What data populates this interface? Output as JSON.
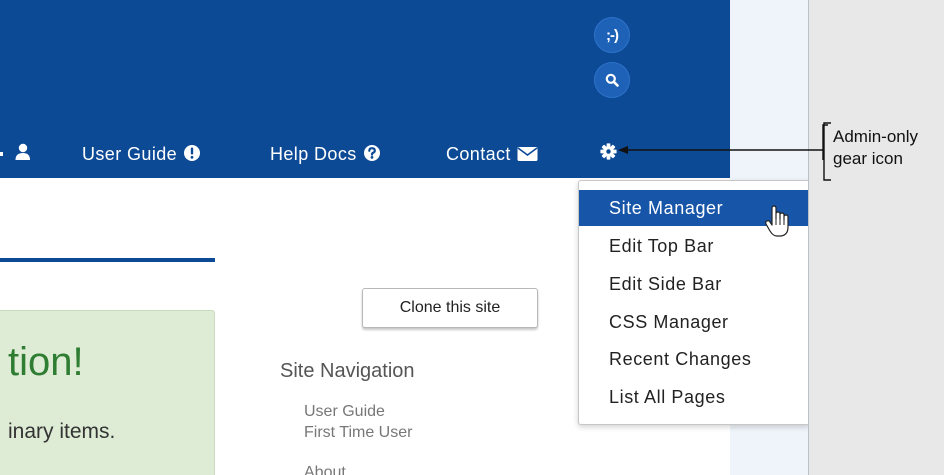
{
  "header": {
    "nav": [
      {
        "label": "User Guide",
        "icon": "exclamation-circle-icon"
      },
      {
        "label": "Help Docs",
        "icon": "question-circle-icon"
      },
      {
        "label": "Contact",
        "icon": "envelope-icon"
      }
    ],
    "partial_icon": "user-icon",
    "gear_icon": "gear-icon",
    "smiley_label": ";-)",
    "search_icon": "search-icon"
  },
  "main": {
    "hero_text": "tion!",
    "sub_text": "inary items.",
    "clone_button": "Clone this site",
    "site_nav": {
      "title": "Site Navigation",
      "links": [
        "User Guide",
        "First Time User",
        "About"
      ]
    }
  },
  "dropdown": {
    "items": [
      "Site Manager",
      "Edit Top Bar",
      "Edit Side Bar",
      "CSS Manager",
      "Recent Changes",
      "List All Pages"
    ],
    "active_index": 0
  },
  "callout": {
    "line1": "Admin-only",
    "line2": "gear icon"
  },
  "colors": {
    "header_bg": "#0d4a96",
    "active_item_bg": "#1655a8",
    "hero_green": "#2e7d32",
    "green_box_bg": "#deecd5"
  }
}
